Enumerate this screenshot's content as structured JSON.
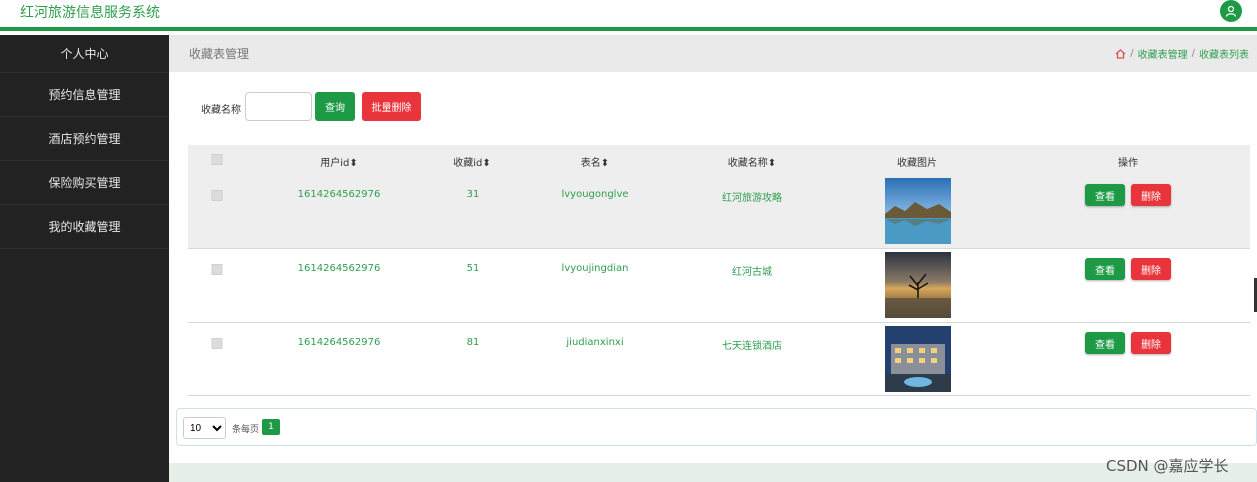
{
  "app": {
    "title": "红河旅游信息服务系统"
  },
  "sidebar": {
    "items": [
      {
        "label": "个人中心"
      },
      {
        "label": "预约信息管理"
      },
      {
        "label": "酒店预约管理"
      },
      {
        "label": "保险购买管理"
      },
      {
        "label": "我的收藏管理"
      }
    ]
  },
  "header": {
    "page_title": "收藏表管理",
    "breadcrumbs": [
      "收藏表管理",
      "收藏表列表"
    ],
    "separator": "/"
  },
  "search": {
    "label": "收藏名称",
    "value": "",
    "query_label": "查询",
    "bulk_delete_label": "批量删除"
  },
  "table": {
    "columns": [
      "用户id",
      "收藏id",
      "表名",
      "收藏名称",
      "收藏图片",
      "操作"
    ],
    "sort_icon": "⬍",
    "view_label": "查看",
    "delete_label": "删除",
    "rows": [
      {
        "user_id": "1614264562976",
        "fav_id": "31",
        "table_name": "lvyougonglve",
        "fav_name": "红河旅游攻略",
        "image": "mountain-lake-photo"
      },
      {
        "user_id": "1614264562976",
        "fav_id": "51",
        "table_name": "lvyoujingdian",
        "fav_name": "红河古城",
        "image": "tree-sunset-lake-photo"
      },
      {
        "user_id": "1614264562976",
        "fav_id": "81",
        "table_name": "jiudianxinxi",
        "fav_name": "七天连锁酒店",
        "image": "hotel-night-photo"
      }
    ]
  },
  "pagination": {
    "page_size": "10",
    "per_page_label": "条每页",
    "current_page": "1"
  },
  "watermark": "CSDN @嘉应学长",
  "colors": {
    "primary": "#1e9a46",
    "danger": "#e8343a",
    "sidebar": "#222222",
    "link": "#2f9e4f"
  }
}
